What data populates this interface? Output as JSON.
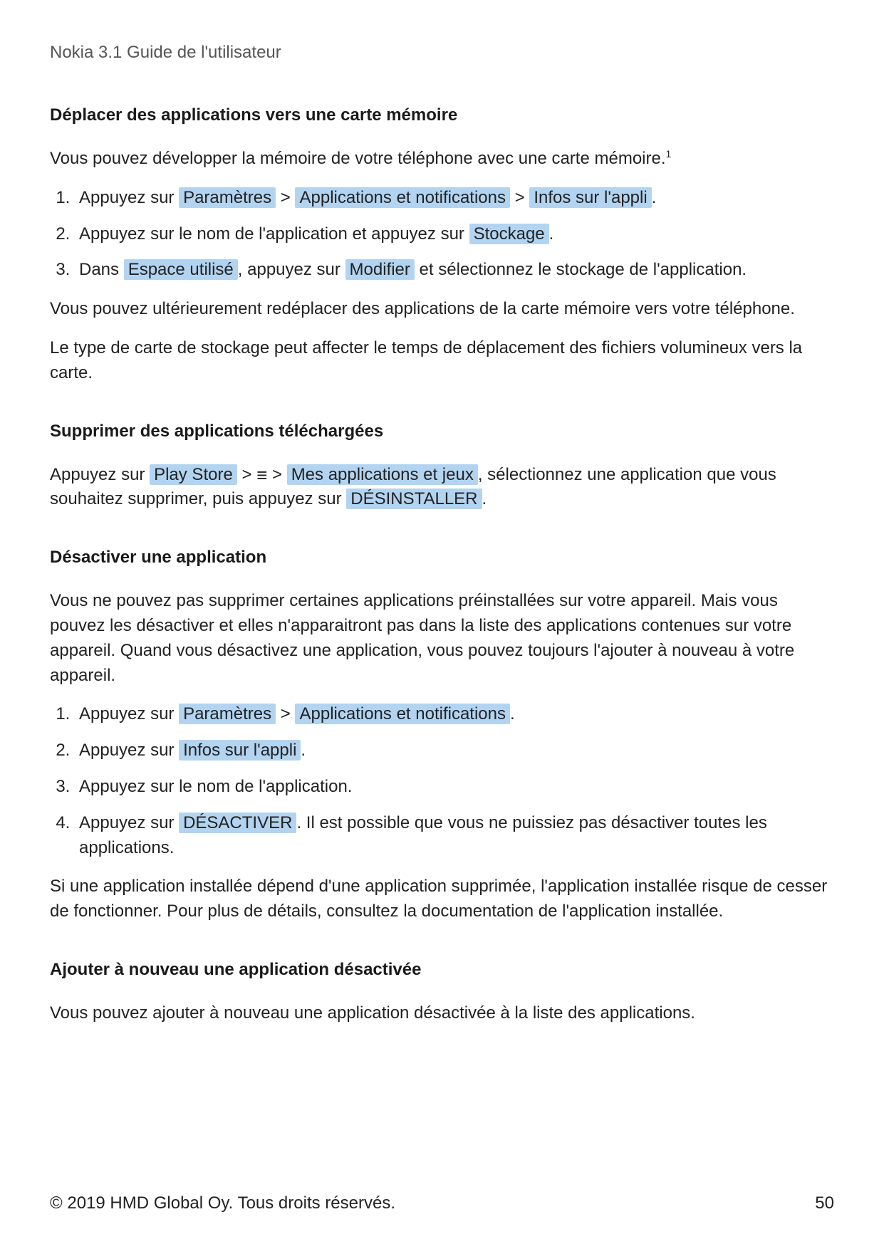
{
  "header": {
    "title": "Nokia 3.1 Guide de l'utilisateur"
  },
  "sections": {
    "s1": {
      "title": "Déplacer des applications vers une carte mémoire",
      "intro": "Vous pouvez développer la mémoire de votre téléphone avec une carte mémoire.",
      "sup": "1",
      "step1a": "Appuyez sur ",
      "ui_settings": "Paramètres",
      "ui_apps_notifs": "Applications et notifications",
      "ui_app_info": "Infos sur l'appli",
      "step1_end": ".",
      "step2a": "Appuyez sur le nom de l'application et appuyez sur ",
      "ui_storage": "Stockage",
      "step2_end": ".",
      "step3a": "Dans ",
      "ui_used_space": "Espace utilisé",
      "step3b": ", appuyez sur ",
      "ui_modify": "Modifier",
      "step3c": " et sélectionnez le stockage de l'application.",
      "after1": "Vous pouvez ultérieurement redéplacer des applications de la carte mémoire vers votre téléphone.",
      "after2": "Le type de carte de stockage peut affecter le temps de déplacement des fichiers volumineux vers la carte."
    },
    "s2": {
      "title": "Supprimer des applications téléchargées",
      "text_a": "Appuyez sur ",
      "ui_play_store": "Play Store",
      "text_b": " > ",
      "hamburger": "≡",
      "text_c": " > ",
      "ui_my_apps": "Mes applications et jeux",
      "text_d": ", sélectionnez une application que vous souhaitez supprimer, puis appuyez sur ",
      "ui_uninstall": "DÉSINSTALLER",
      "text_e": "."
    },
    "s3": {
      "title": "Désactiver une application",
      "intro": "Vous ne pouvez pas supprimer certaines applications préinstallées sur votre appareil. Mais vous pouvez les désactiver et elles n'apparaitront pas dans la liste des applications contenues sur votre appareil. Quand vous désactivez une application, vous pouvez toujours l'ajouter à nouveau à votre appareil.",
      "step1a": "Appuyez sur ",
      "ui_settings": "Paramètres",
      "ui_apps_notifs": "Applications et notifications",
      "step1_end": ".",
      "step2a": "Appuyez sur ",
      "ui_app_info": "Infos sur l'appli",
      "step2_end": ".",
      "step3": "Appuyez sur le nom de l'application.",
      "step4a": "Appuyez sur ",
      "ui_disable": "DÉSACTIVER",
      "step4b": ". Il est possible que vous ne puissiez pas désactiver toutes les applications.",
      "after1": "Si une application installée dépend d'une application supprimée, l'application installée risque de cesser de fonctionner. Pour plus de détails, consultez la documentation de l'application installée."
    },
    "s4": {
      "title": "Ajouter à nouveau une application désactivée",
      "intro": "Vous pouvez ajouter à nouveau une application désactivée à la liste des applications."
    }
  },
  "footer": {
    "copyright": "© 2019 HMD Global Oy. Tous droits réservés.",
    "page_number": "50"
  }
}
